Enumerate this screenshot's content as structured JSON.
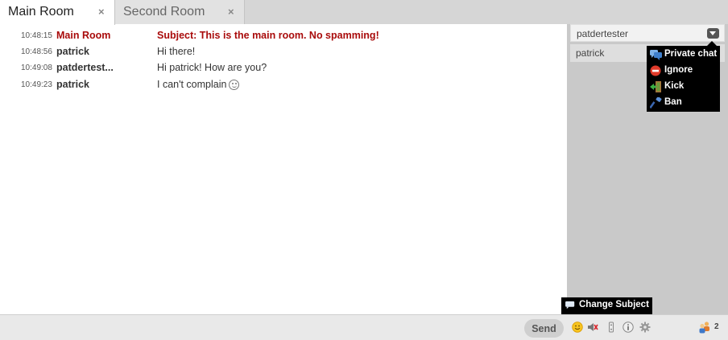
{
  "tabs": [
    {
      "label": "Main Room",
      "close": "×",
      "active": true
    },
    {
      "label": "Second Room",
      "close": "×",
      "active": false
    }
  ],
  "messages": [
    {
      "time": "10:48:15",
      "nick": "Main Room",
      "text": "Subject: This is the main room. No spamming!",
      "type": "subject"
    },
    {
      "time": "10:48:56",
      "nick": "patrick",
      "text": "Hi there!"
    },
    {
      "time": "10:49:08",
      "nick": "patdertest...",
      "text": "Hi patrick! How are you?"
    },
    {
      "time": "10:49:23",
      "nick": "patrick",
      "text": "I can't complain",
      "emoticon": "smiley-icon"
    }
  ],
  "roster": {
    "users": [
      {
        "name": "patdertester"
      },
      {
        "name": "patrick"
      }
    ],
    "user_count": "2"
  },
  "context_menu": {
    "items": [
      {
        "label": "Private chat",
        "icon": "speech-bubbles-icon"
      },
      {
        "label": "Ignore",
        "icon": "no-entry-icon"
      },
      {
        "label": "Kick",
        "icon": "door-exit-icon"
      },
      {
        "label": "Ban",
        "icon": "hammer-icon"
      }
    ]
  },
  "tooltip": {
    "label": "Change Subject",
    "icon": "speech-bubble-icon"
  },
  "toolbar": {
    "send_label": "Send",
    "tools": [
      "emoticon-icon",
      "sound-muted-icon",
      "autoscroll-icon",
      "info-icon",
      "settings-gear-icon"
    ]
  },
  "colors": {
    "subject": "#a90b0b",
    "tab_bar": "#d6d6d6",
    "roster_bg": "#c9c9c9",
    "menu_bg": "#000000"
  }
}
